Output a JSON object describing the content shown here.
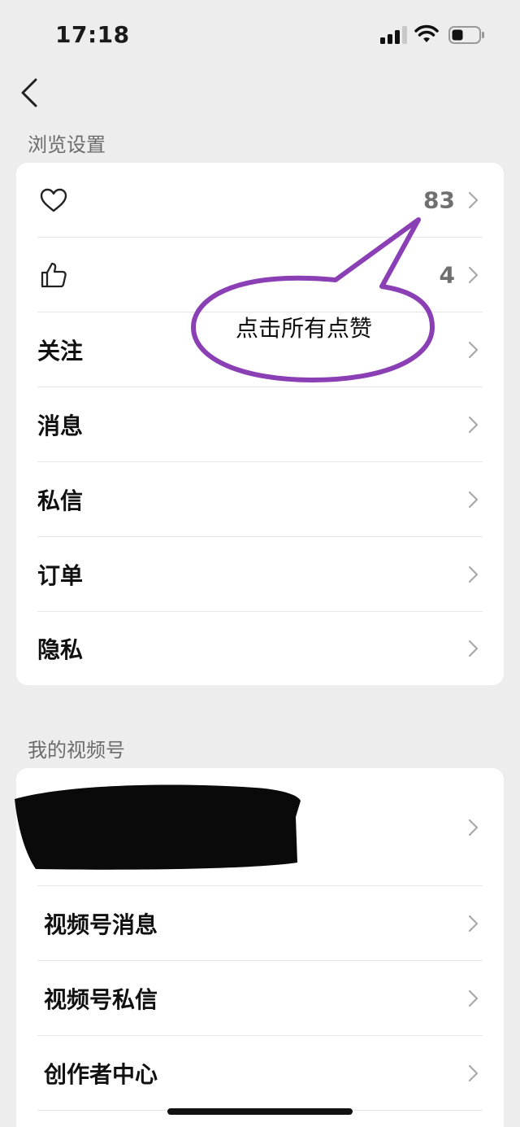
{
  "status_bar": {
    "time": "17:18"
  },
  "browse_settings": {
    "title": "浏览设置",
    "likes_count": "83",
    "thumbs_count": "4",
    "items": [
      {
        "label": "关注"
      },
      {
        "label": "消息"
      },
      {
        "label": "私信"
      },
      {
        "label": "订单"
      },
      {
        "label": "隐私"
      }
    ]
  },
  "annotation": {
    "text": "点击所有点赞",
    "color": "#8b3fb5"
  },
  "my_channels": {
    "title": "我的视频号",
    "items": [
      {
        "label": "视频号消息"
      },
      {
        "label": "视频号私信"
      },
      {
        "label": "创作者中心"
      }
    ]
  }
}
